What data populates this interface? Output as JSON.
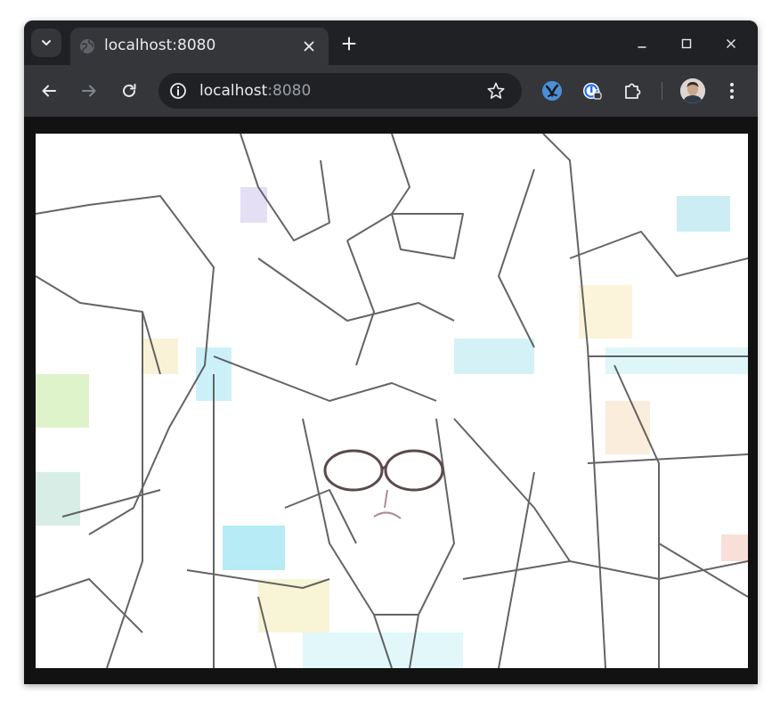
{
  "tab": {
    "title": "localhost:8080"
  },
  "omnibox": {
    "host": "localhost",
    "port": ":8080"
  },
  "icons": {
    "tab_search": "chevron-down-icon",
    "favicon": "globe-icon",
    "tab_close": "close-icon",
    "new_tab": "plus-icon",
    "minimize": "minimize-icon",
    "maximize": "maximize-icon",
    "close": "close-icon",
    "back": "arrow-left-icon",
    "forward": "arrow-right-icon",
    "reload": "reload-icon",
    "site_info": "info-icon",
    "bookmark": "star-icon",
    "extension_1": "bird-icon",
    "extension_2": "password-icon",
    "extensions": "puzzle-icon",
    "profile": "avatar",
    "menu": "kebab-menu-icon"
  },
  "colors": {
    "tabstrip": "#202124",
    "toolbar": "#35363a",
    "omnibox": "#202124",
    "text": "#e8eaed",
    "muted_text": "#9aa0a6",
    "page_background": "#121212",
    "canvas_background": "#ffffff"
  },
  "page": {
    "content": "stylized line-art webcam canvas"
  }
}
